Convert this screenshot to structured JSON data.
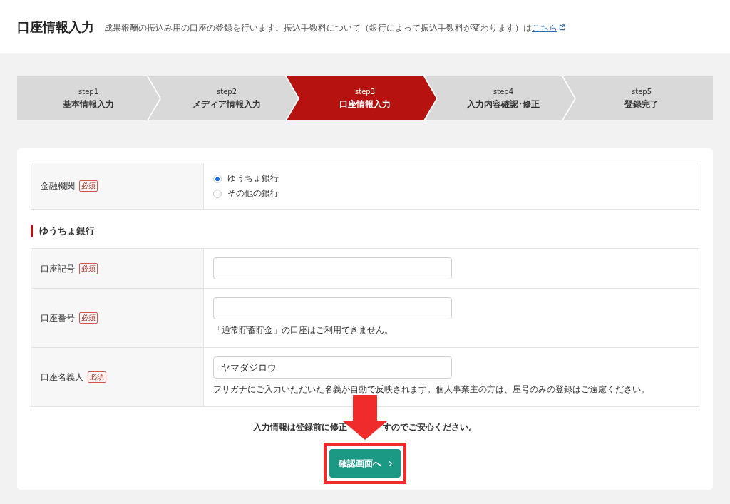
{
  "header": {
    "title": "口座情報入力",
    "description": "成果報酬の振込み用の口座の登録を行います。振込手数料について（銀行によって振込手数料が変わります）は",
    "link": "こちら"
  },
  "steps": [
    {
      "step": "step1",
      "label": "基本情報入力",
      "selected": false
    },
    {
      "step": "step2",
      "label": "メディア情報入力",
      "selected": false
    },
    {
      "step": "step3",
      "label": "口座情報入力",
      "selected": true
    },
    {
      "step": "step4",
      "label": "入力内容確認･修正",
      "selected": false
    },
    {
      "step": "step5",
      "label": "登録完了",
      "selected": false
    }
  ],
  "bank": {
    "label": "金融機関",
    "badge": "必須",
    "options": [
      {
        "label": "ゆうちょ銀行",
        "selected": true
      },
      {
        "label": "その他の銀行",
        "selected": false
      }
    ]
  },
  "section_title": "ゆうちょ銀行",
  "fields": [
    {
      "label": "口座記号",
      "badge": "必須"
    },
    {
      "label": "口座番号",
      "badge": "必須",
      "hint": "「通常貯蓄貯金」の口座はご利用できません。"
    },
    {
      "label": "口座名義人",
      "badge": "必須",
      "value": "ヤマダジロウ",
      "hint": "フリガナにご入力いただいた名義が自動で反映されます。個人事業主の方は、屋号のみの登録はご遠慮ください。"
    }
  ],
  "note": [
    "入力情報は登録前に修正",
    "すのでご安心ください。"
  ],
  "button": {
    "label": "確認画面へ"
  },
  "annotation": {
    "arrow": true,
    "frame": true
  }
}
